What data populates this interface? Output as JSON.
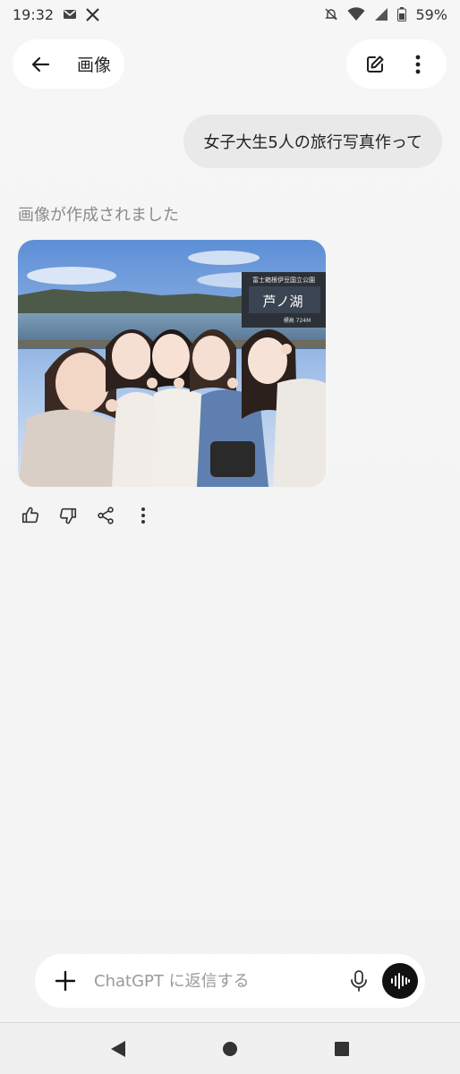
{
  "status_bar": {
    "time": "19:32",
    "battery": "59%",
    "icons": [
      "mail-icon",
      "x-logo-icon",
      "notifications-muted-icon",
      "wifi-icon",
      "signal-icon",
      "battery-icon"
    ]
  },
  "header": {
    "title": "画像",
    "icons": [
      "back-arrow-icon",
      "edit-icon",
      "more-vert-icon"
    ]
  },
  "conversation": {
    "user_message": "女子大生5人の旅行写真作って",
    "assistant_label": "画像が作成されました",
    "image_sign": {
      "small_text": "富士箱根伊豆国立公園",
      "big_text": "芦ノ湖",
      "elevation": "標高 724M"
    },
    "action_icons": [
      "thumbs-up-icon",
      "thumbs-down-icon",
      "share-icon",
      "more-vert-icon"
    ]
  },
  "composer": {
    "placeholder": "ChatGPT に返信する",
    "icons": [
      "plus-icon",
      "mic-icon",
      "voice-mode-icon"
    ]
  },
  "nav": {
    "icons": [
      "nav-back-icon",
      "nav-home-icon",
      "nav-recents-icon"
    ]
  },
  "colors": {
    "background": "#f5f5f5",
    "bubble": "#e9e9e9",
    "voice_button": "#111111"
  }
}
